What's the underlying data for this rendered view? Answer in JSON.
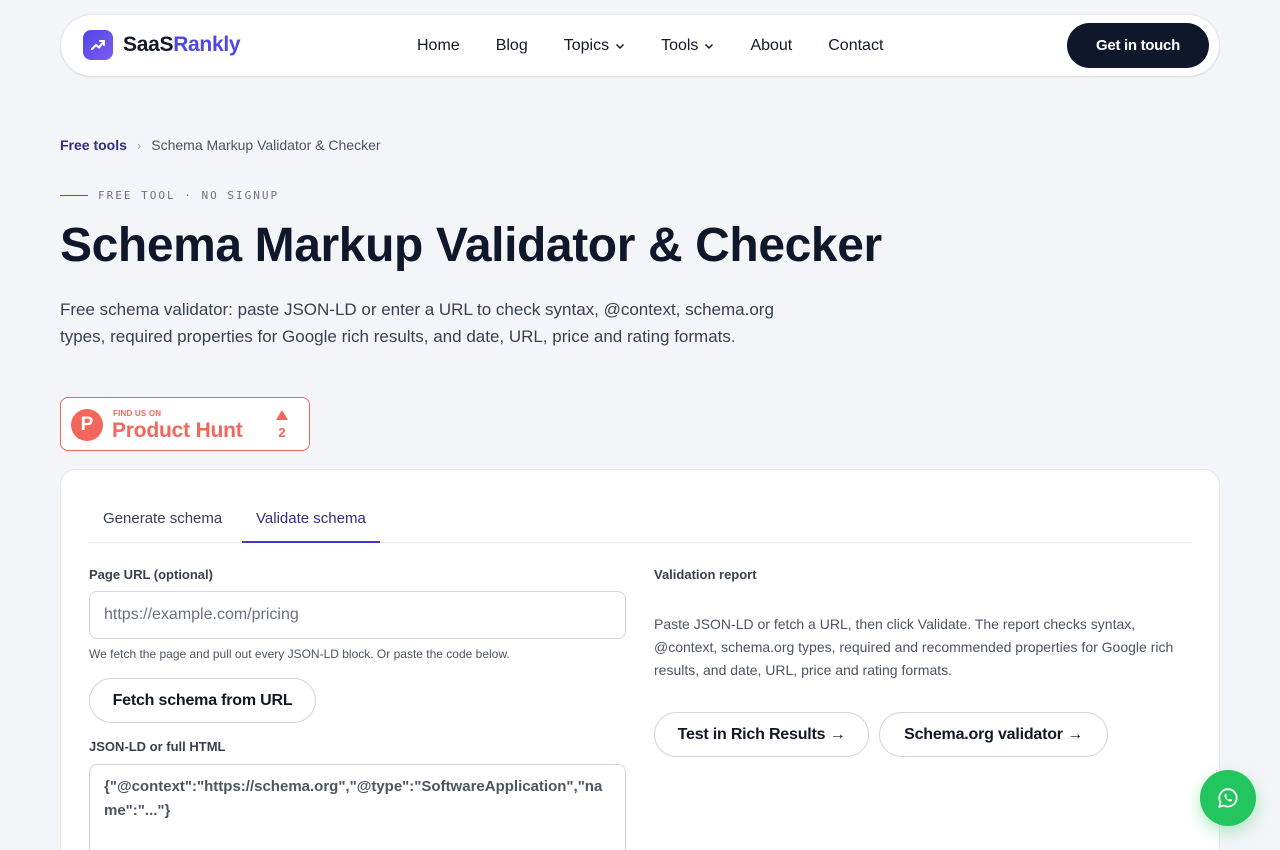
{
  "brand": {
    "part1": "SaaS",
    "part2": "Rankly"
  },
  "nav": {
    "items": [
      {
        "label": "Home",
        "dropdown": false
      },
      {
        "label": "Blog",
        "dropdown": false
      },
      {
        "label": "Topics",
        "dropdown": true
      },
      {
        "label": "Tools",
        "dropdown": true
      },
      {
        "label": "About",
        "dropdown": false
      },
      {
        "label": "Contact",
        "dropdown": false
      }
    ],
    "cta": "Get in touch"
  },
  "breadcrumb": {
    "parent": "Free tools",
    "separator": "›",
    "current": "Schema Markup Validator & Checker"
  },
  "eyebrow": "FREE TOOL · NO SIGNUP",
  "title": "Schema Markup Validator & Checker",
  "lead": "Free schema validator: paste JSON-LD or enter a URL to check syntax, @context, schema.org types, required properties for Google rich results, and date, URL, price and rating formats.",
  "product_hunt": {
    "small": "FIND US ON",
    "big": "Product Hunt",
    "letter": "P",
    "upvotes": "2"
  },
  "tool": {
    "tabs": [
      "Generate schema",
      "Validate schema"
    ],
    "active_tab": "Validate schema",
    "url_label": "Page URL (optional)",
    "url_placeholder": "https://example.com/pricing",
    "url_hint": "We fetch the page and pull out every JSON-LD block. Or paste the code below.",
    "fetch_button": "Fetch schema from URL",
    "code_label": "JSON-LD or full HTML",
    "code_value": "{\"@context\":\"https://schema.org\",\"@type\":\"SoftwareApplication\",\"name\":\"...\"}",
    "report_label": "Validation report",
    "report_text": "Paste JSON-LD or fetch a URL, then click Validate. The report checks syntax, @context, schema.org types, required and recommended properties for Google rich results, and date, URL, price and rating formats.",
    "rich_results_button": "Test in Rich Results →",
    "schema_org_button": "Schema.org validator →"
  },
  "colors": {
    "accent": "#4f46e5",
    "dark": "#0f172a",
    "product_hunt": "#f2665b",
    "whatsapp": "#22c55e"
  },
  "icons": {
    "logo": "trending-up-icon",
    "dropdown": "chevron-down-icon",
    "chat": "whatsapp-icon"
  }
}
